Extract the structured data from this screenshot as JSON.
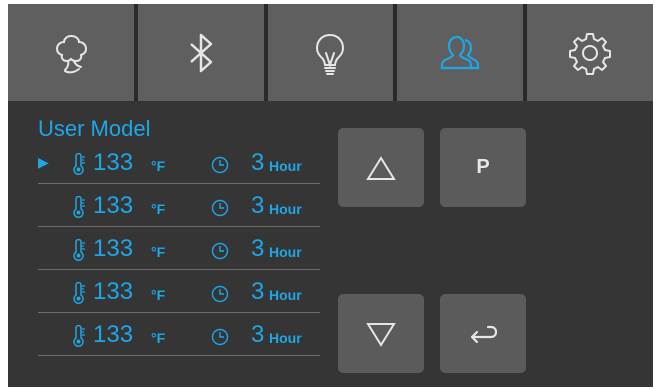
{
  "tabs": [
    {
      "icon": "cloud-tree-icon"
    },
    {
      "icon": "bluetooth-icon"
    },
    {
      "icon": "lightbulb-icon"
    },
    {
      "icon": "user-icon",
      "active": true
    },
    {
      "icon": "gear-icon"
    }
  ],
  "section_title": "User Model",
  "rows": [
    {
      "selected": true,
      "temp": "133",
      "temp_unit": "°F",
      "time": "3",
      "time_unit": "Hour"
    },
    {
      "selected": false,
      "temp": "133",
      "temp_unit": "°F",
      "time": "3",
      "time_unit": "Hour"
    },
    {
      "selected": false,
      "temp": "133",
      "temp_unit": "°F",
      "time": "3",
      "time_unit": "Hour"
    },
    {
      "selected": false,
      "temp": "133",
      "temp_unit": "°F",
      "time": "3",
      "time_unit": "Hour"
    },
    {
      "selected": false,
      "temp": "133",
      "temp_unit": "°F",
      "time": "3",
      "time_unit": "Hour"
    }
  ],
  "cursor_glyph": "▶",
  "buttons": {
    "up": {
      "icon": "triangle-up-icon"
    },
    "down": {
      "icon": "triangle-down-icon"
    },
    "program": {
      "label": "P"
    },
    "back": {
      "icon": "return-arrow-icon"
    }
  },
  "colors": {
    "accent": "#1ea7e6",
    "panel": "#353535",
    "tab": "#5f5f5f",
    "button": "#5b5b5b",
    "icon": "#e6e6e6"
  }
}
